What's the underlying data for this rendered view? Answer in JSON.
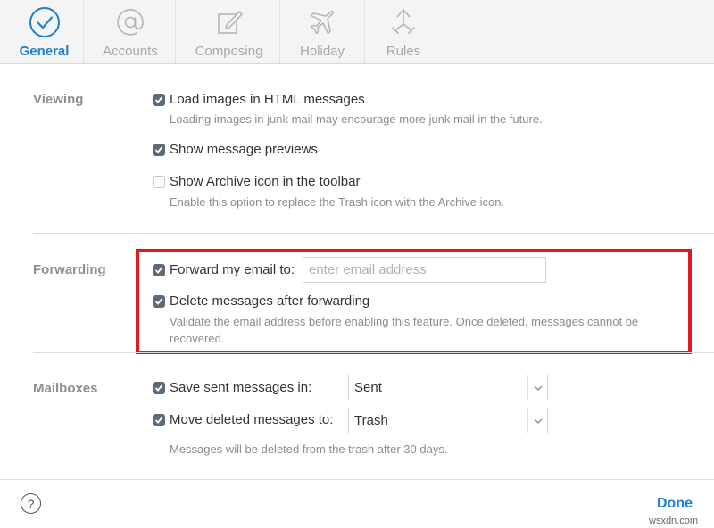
{
  "colors": {
    "accent": "#1c7fd6",
    "checkbox": "#5d6a79",
    "highlight": "#e0191e"
  },
  "toolbar": {
    "tabs": [
      {
        "label": "General",
        "icon": "checkmark-circle-icon",
        "active": true
      },
      {
        "label": "Accounts",
        "icon": "at-sign-icon",
        "active": false
      },
      {
        "label": "Composing",
        "icon": "compose-icon",
        "active": false
      },
      {
        "label": "Holiday",
        "icon": "airplane-icon",
        "active": false
      },
      {
        "label": "Rules",
        "icon": "arrows-icon",
        "active": false
      }
    ]
  },
  "viewing": {
    "title": "Viewing",
    "load_images": {
      "label": "Load images in HTML messages",
      "checked": true,
      "help": "Loading images in junk mail may encourage more junk mail in the future."
    },
    "show_previews": {
      "label": "Show message previews",
      "checked": true
    },
    "show_archive": {
      "label": "Show Archive icon in the toolbar",
      "checked": false,
      "help": "Enable this option to replace the Trash icon with the Archive icon."
    }
  },
  "forwarding": {
    "title": "Forwarding",
    "forward_email": {
      "label": "Forward my email to:",
      "checked": true,
      "placeholder": "enter email address",
      "value": ""
    },
    "delete_after": {
      "label": "Delete messages after forwarding",
      "checked": true,
      "help_line1": "Validate the email address before enabling this feature. Once deleted, messages cannot be",
      "help_line2": "recovered."
    }
  },
  "mailboxes": {
    "title": "Mailboxes",
    "save_sent": {
      "label": "Save sent messages in:",
      "checked": true,
      "selected": "Sent"
    },
    "move_deleted": {
      "label": "Move deleted messages to:",
      "checked": true,
      "selected": "Trash"
    },
    "help": "Messages will be deleted from the trash after 30 days."
  },
  "footer": {
    "help_symbol": "?",
    "done_label": "Done",
    "watermark": "wsxdn.com"
  }
}
